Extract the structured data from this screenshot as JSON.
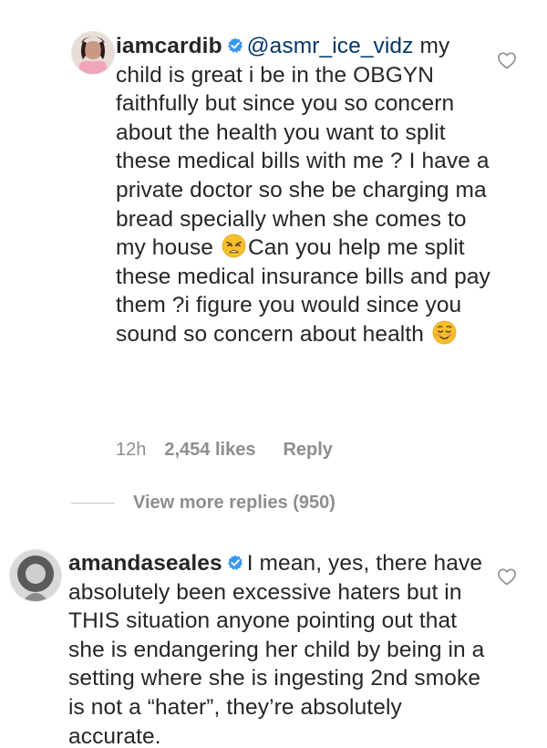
{
  "comments": [
    {
      "username": "iamcardib",
      "mention": "@asmr_ice_vidz",
      "text_before_emoji1": "my child is great i be in the OBGYN faithfully but since you so concern about the health you want to split these medical bills with me ? I have a private doctor so she be charging  ma bread specially when she comes to my house",
      "text_after_emoji1": "Can you help me split these medical insurance bills and pay them ?i figure you would since you sound so concern about health",
      "emoji1": "weary-face-emoji",
      "emoji2": "relieved-smile-emoji",
      "time": "12h",
      "likes": "2,454 likes",
      "reply_label": "Reply"
    },
    {
      "username": "amandaseales",
      "text": "I mean, yes, there have absolutely been excessive haters but in THIS situation anyone pointing out that she is endangering her child by being in a setting where she is ingesting 2nd smoke is not a “hater”, they’re absolutely accurate."
    }
  ],
  "view_more": "View more replies (950)",
  "colors": {
    "text": "#262626",
    "secondary": "#8e8e8e",
    "mention": "#00376b",
    "verified": "#3897f0"
  }
}
